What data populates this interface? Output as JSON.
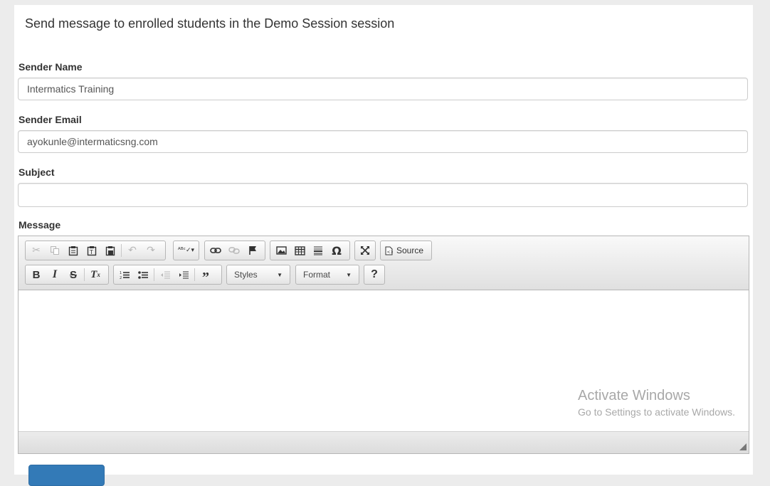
{
  "page": {
    "title": "Send message to enrolled students in the Demo Session session"
  },
  "form": {
    "sender_name": {
      "label": "Sender Name",
      "value": "Intermatics Training"
    },
    "sender_email": {
      "label": "Sender Email",
      "value": "ayokunle@intermaticsng.com"
    },
    "subject": {
      "label": "Subject",
      "value": ""
    },
    "message": {
      "label": "Message"
    }
  },
  "editor": {
    "source_label": "Source",
    "styles_label": "Styles",
    "format_label": "Format",
    "help_label": "?",
    "toolbar_row1": [
      "cut-icon",
      "copy-icon",
      "paste-icon",
      "paste-text-icon",
      "paste-word-icon",
      "undo-icon",
      "redo-icon",
      "spellcheck-icon",
      "link-icon",
      "unlink-icon",
      "anchor-icon",
      "image-icon",
      "table-icon",
      "horizontal-rule-icon",
      "special-char-icon",
      "maximize-icon",
      "source-icon"
    ],
    "toolbar_row2": [
      "bold-icon",
      "italic-icon",
      "strike-icon",
      "remove-format-icon",
      "numbered-list-icon",
      "bulleted-list-icon",
      "outdent-icon",
      "indent-icon",
      "blockquote-icon"
    ]
  },
  "watermark": {
    "line1": "Activate Windows",
    "line2": "Go to Settings to activate Windows."
  },
  "colors": {
    "primary_button": "#337ab7",
    "toolbar_bg": "#e4e4e4"
  }
}
